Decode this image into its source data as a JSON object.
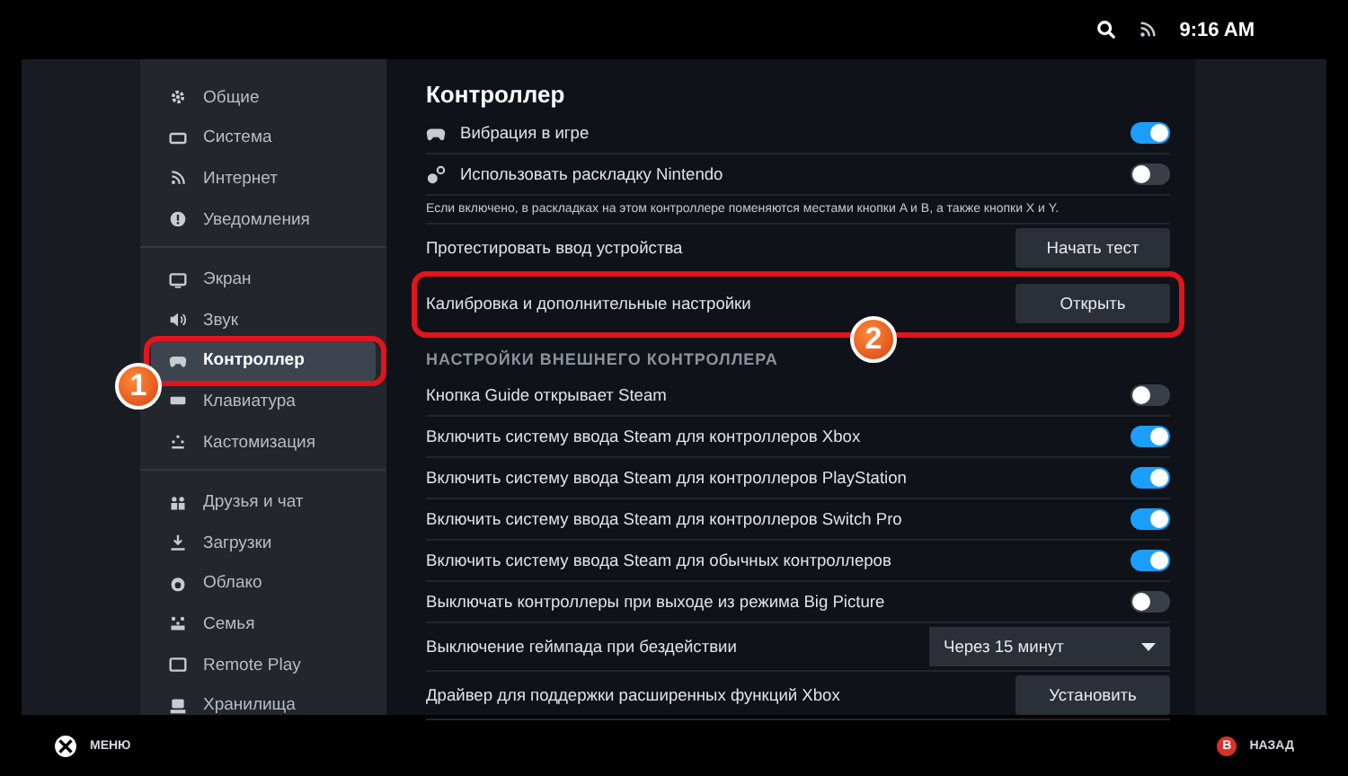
{
  "status_bar": {
    "time": "9:16 AM"
  },
  "sidebar": {
    "groups": [
      {
        "items": [
          {
            "label": "Общие",
            "selected": false
          },
          {
            "label": "Система",
            "selected": false
          },
          {
            "label": "Интернет",
            "selected": false
          },
          {
            "label": "Уведомления",
            "selected": false
          }
        ]
      },
      {
        "items": [
          {
            "label": "Экран",
            "selected": false
          },
          {
            "label": "Звук",
            "selected": false
          },
          {
            "label": "Контроллер",
            "selected": true,
            "callout": "1"
          },
          {
            "label": "Клавиатура",
            "selected": false
          },
          {
            "label": "Кастомизация",
            "selected": false
          }
        ]
      },
      {
        "items": [
          {
            "label": "Друзья и чат",
            "selected": false
          },
          {
            "label": "Загрузки",
            "selected": false
          },
          {
            "label": "Облако",
            "selected": false
          },
          {
            "label": "Семья",
            "selected": false
          },
          {
            "label": "Remote Play",
            "selected": false
          },
          {
            "label": "Хранилища",
            "selected": false
          }
        ]
      }
    ]
  },
  "content": {
    "title": "Контроллер",
    "rows": [
      {
        "kind": "toggle",
        "label": "Вибрация в игре",
        "on": true
      },
      {
        "kind": "toggle",
        "label": "Использовать раскладку Nintendo",
        "on": false
      },
      {
        "kind": "note",
        "label": "Если включено, в раскладках на этом контроллере поменяются местами кнопки A и B, а также кнопки X и Y."
      },
      {
        "kind": "button",
        "label": "Протестировать ввод устройства",
        "button": "Начать тест"
      },
      {
        "kind": "button",
        "label": "Калибровка и дополнительные настройки",
        "button": "Открыть",
        "callout": "2"
      },
      {
        "kind": "header",
        "label": "НАСТРОЙКИ ВНЕШНЕГО КОНТРОЛЛЕРА"
      },
      {
        "kind": "toggle",
        "label": "Кнопка Guide открывает Steam",
        "on": false
      },
      {
        "kind": "toggle",
        "label": "Включить систему ввода Steam для контроллеров Xbox",
        "on": true
      },
      {
        "kind": "toggle",
        "label": "Включить систему ввода Steam для контроллеров PlayStation",
        "on": true
      },
      {
        "kind": "toggle",
        "label": "Включить систему ввода Steam для контроллеров Switch Pro",
        "on": true
      },
      {
        "kind": "toggle",
        "label": "Включить систему ввода Steam для обычных контроллеров",
        "on": true
      },
      {
        "kind": "toggle",
        "label": "Выключать контроллеры при выходе из режима Big Picture",
        "on": false
      },
      {
        "kind": "dropdown",
        "label": "Выключение геймпада при бездействии",
        "value": "Через 15 минут"
      },
      {
        "kind": "button",
        "label": "Драйвер для поддержки расширенных функций Xbox",
        "button": "Установить"
      }
    ]
  },
  "footer": {
    "menu": "МЕНЮ",
    "back_key": "B",
    "back": "НАЗАД"
  }
}
